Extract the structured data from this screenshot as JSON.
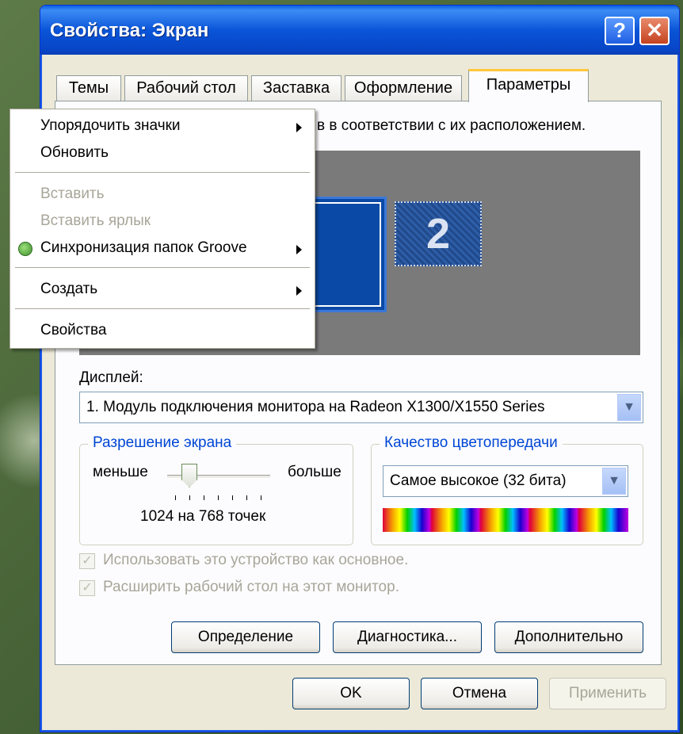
{
  "window": {
    "title": "Свойства: Экран",
    "help_label": "?",
    "close_label": "✕"
  },
  "tabs": [
    {
      "label": "Темы"
    },
    {
      "label": "Рабочий стол"
    },
    {
      "label": "Заставка"
    },
    {
      "label": "Оформление"
    },
    {
      "label": "Параметры",
      "active": true
    }
  ],
  "settings": {
    "description": "в в соответствии с их расположением.",
    "monitor2_label": "2",
    "display_label": "Дисплей:",
    "display_value": "1. Модуль подключения монитора на Radeon X1300/X1550 Series",
    "resolution": {
      "title": "Разрешение экрана",
      "less": "меньше",
      "more": "больше",
      "value_text": "1024 на 768 точек"
    },
    "color_quality": {
      "title": "Качество цветопередачи",
      "value": "Самое высокое (32 бита)"
    },
    "checkboxes": [
      {
        "label": "Использовать это устройство как основное.",
        "checked": true,
        "disabled": true
      },
      {
        "label": "Расширить рабочий стол на этот монитор.",
        "checked": true,
        "disabled": true
      }
    ],
    "buttons": {
      "identify": "Определение",
      "troubleshoot": "Диагностика...",
      "advanced": "Дополнительно"
    }
  },
  "dialog_buttons": {
    "ok": "OK",
    "cancel": "Отмена",
    "apply": "Применить"
  },
  "context_menu": {
    "items": [
      {
        "label": "Упорядочить значки",
        "submenu": true
      },
      {
        "label": "Обновить"
      },
      {
        "label": "Вставить",
        "disabled": true
      },
      {
        "label": "Вставить ярлык",
        "disabled": true
      },
      {
        "label": "Синхронизация папок Groove",
        "submenu": true,
        "icon": "groove-icon"
      },
      {
        "label": "Создать",
        "submenu": true
      },
      {
        "label": "Свойства"
      }
    ]
  },
  "colors": {
    "titlebar": "#0a55d8",
    "group_title": "#0046d5",
    "tab_highlight": "#ffc83c"
  }
}
